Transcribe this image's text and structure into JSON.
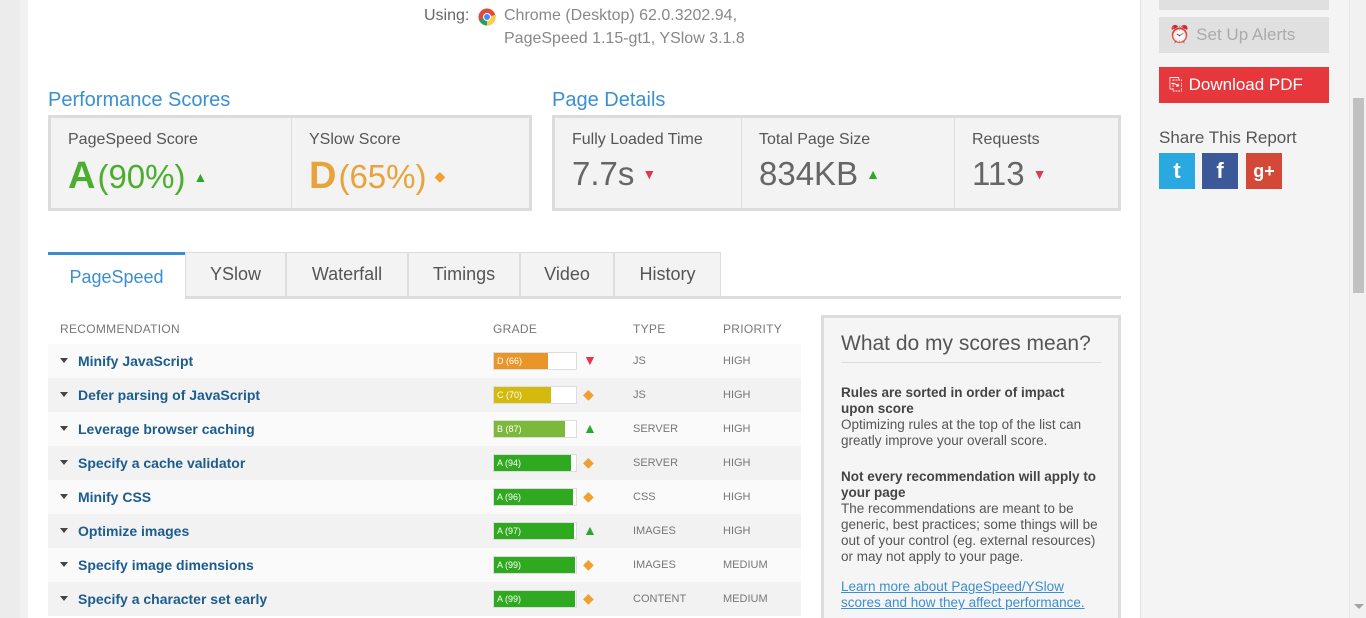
{
  "test_info": {
    "using_label": "Using:",
    "browser": "Chrome (Desktop) 62.0.3202.94,",
    "versions": "PageSpeed 1.15-gt1, YSlow 3.1.8"
  },
  "performance": {
    "title": "Performance Scores",
    "pagespeed": {
      "label": "PageSpeed Score",
      "grade": "A",
      "percent": "(90%)",
      "color": "#4cae2e"
    },
    "yslow": {
      "label": "YSlow Score",
      "grade": "D",
      "percent": "(65%)",
      "color": "#e8a33a"
    }
  },
  "details": {
    "title": "Page Details",
    "loaded": {
      "label": "Fully Loaded Time",
      "value": "7.7s"
    },
    "size": {
      "label": "Total Page Size",
      "value": "834KB"
    },
    "requests": {
      "label": "Requests",
      "value": "113"
    }
  },
  "tabs": [
    "PageSpeed",
    "YSlow",
    "Waterfall",
    "Timings",
    "Video",
    "History"
  ],
  "table": {
    "headers": {
      "rec": "RECOMMENDATION",
      "grade": "GRADE",
      "type": "TYPE",
      "priority": "PRIORITY"
    },
    "rows": [
      {
        "name": "Minify JavaScript",
        "grade": "D (66)",
        "score": 66,
        "color": "#e8962a",
        "ind": "down",
        "type": "JS",
        "priority": "HIGH"
      },
      {
        "name": "Defer parsing of JavaScript",
        "grade": "C (70)",
        "score": 70,
        "color": "#d4b90f",
        "ind": "neutral",
        "type": "JS",
        "priority": "HIGH"
      },
      {
        "name": "Leverage browser caching",
        "grade": "B (87)",
        "score": 87,
        "color": "#7cb83a",
        "ind": "up",
        "type": "SERVER",
        "priority": "HIGH"
      },
      {
        "name": "Specify a cache validator",
        "grade": "A (94)",
        "score": 94,
        "color": "#2fa91f",
        "ind": "neutral",
        "type": "SERVER",
        "priority": "HIGH"
      },
      {
        "name": "Minify CSS",
        "grade": "A (96)",
        "score": 96,
        "color": "#2fa91f",
        "ind": "neutral",
        "type": "CSS",
        "priority": "HIGH"
      },
      {
        "name": "Optimize images",
        "grade": "A (97)",
        "score": 97,
        "color": "#2fa91f",
        "ind": "up",
        "type": "IMAGES",
        "priority": "HIGH"
      },
      {
        "name": "Specify image dimensions",
        "grade": "A (99)",
        "score": 99,
        "color": "#2fa91f",
        "ind": "neutral",
        "type": "IMAGES",
        "priority": "MEDIUM"
      },
      {
        "name": "Specify a character set early",
        "grade": "A (99)",
        "score": 99,
        "color": "#2fa91f",
        "ind": "neutral",
        "type": "CONTENT",
        "priority": "MEDIUM"
      }
    ]
  },
  "explain": {
    "title": "What do my scores mean?",
    "p1_bold": "Rules are sorted in order of impact upon score",
    "p1": "Optimizing rules at the top of the list can greatly improve your overall score.",
    "p2_bold": "Not every recommendation will apply to your page",
    "p2": "The recommendations are meant to be generic, best practices; some things will be out of your control (eg. external resources) or may not apply to your page.",
    "link": "Learn more about PageSpeed/YSlow scores and how they affect performance."
  },
  "sidebar": {
    "alerts_label": "Set Up Alerts",
    "pdf_label": "Download PDF",
    "share_title": "Share This Report",
    "social": [
      {
        "icon": "twitter-icon",
        "glyph": "t",
        "color": "#2aa9e0"
      },
      {
        "icon": "facebook-icon",
        "glyph": "f",
        "color": "#3b5998"
      },
      {
        "icon": "google-plus-icon",
        "glyph": "g+",
        "color": "#d34836"
      }
    ]
  }
}
